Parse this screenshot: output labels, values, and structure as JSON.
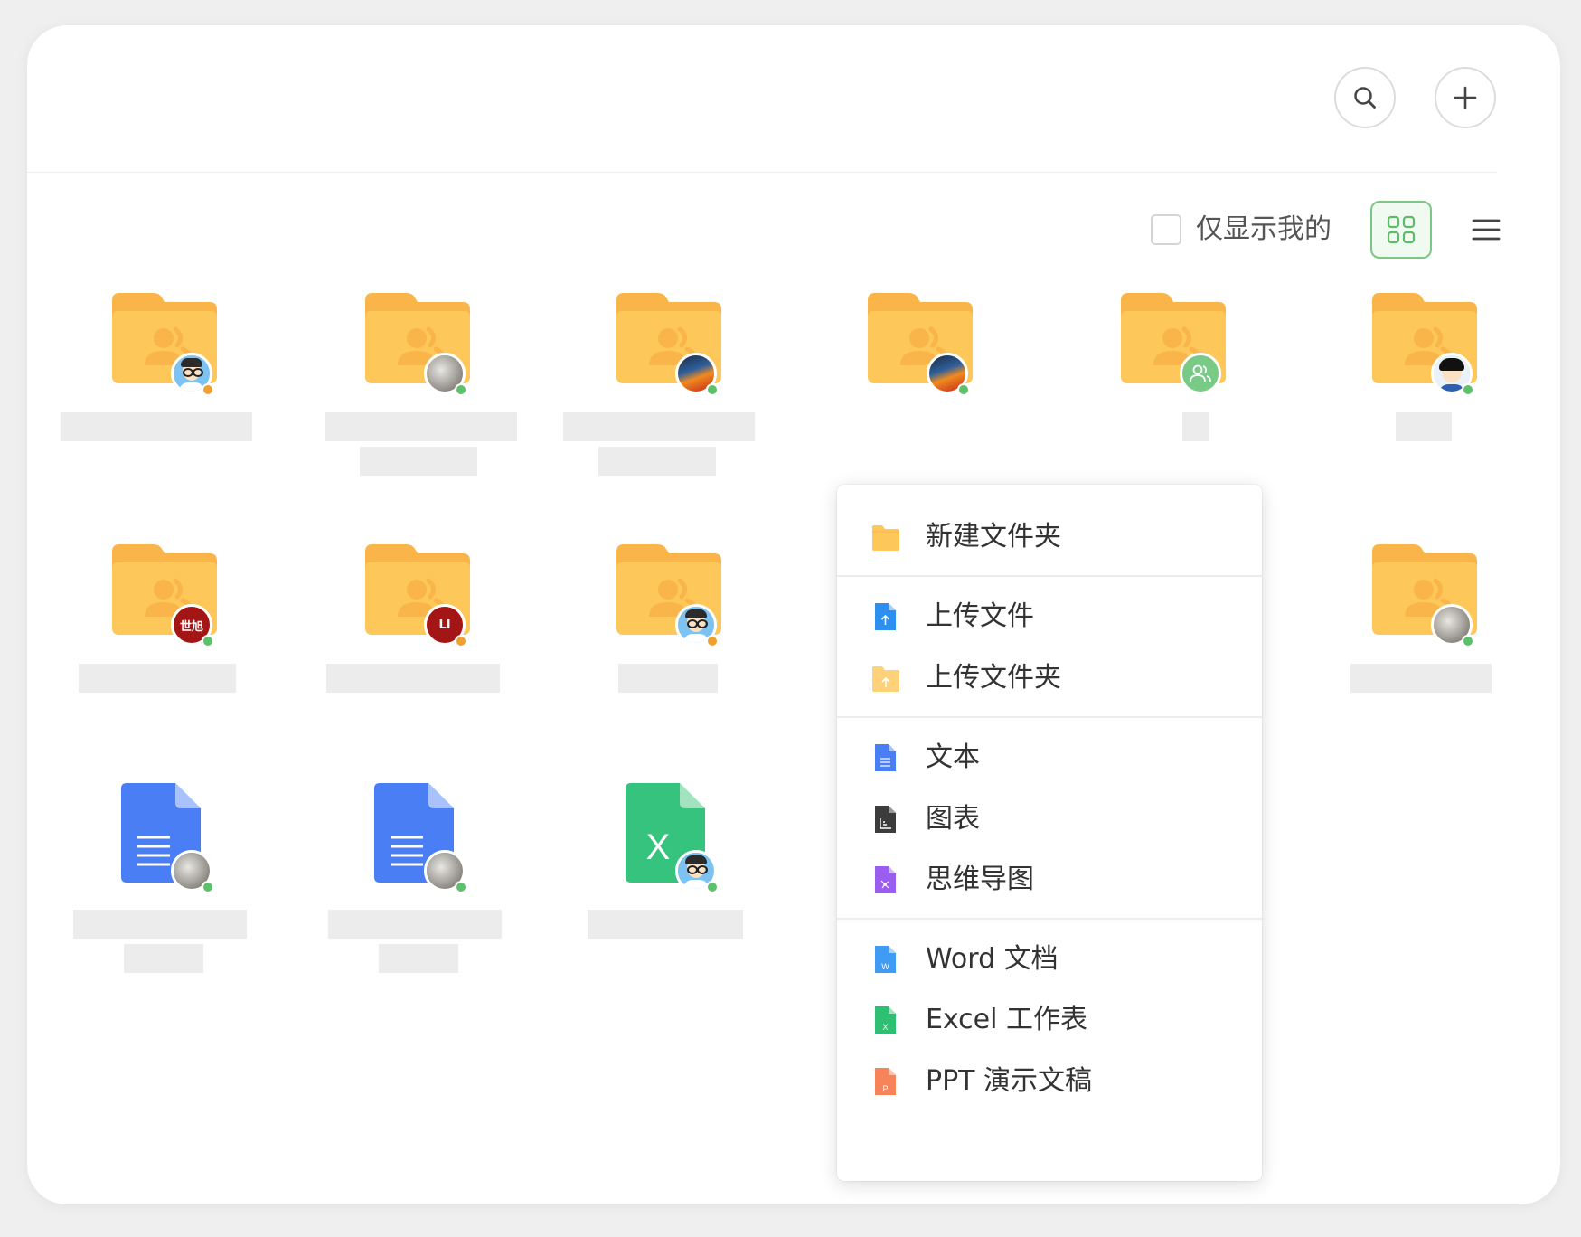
{
  "toolbar": {
    "only_mine_label": "仅显示我的"
  },
  "items": [
    {
      "kind": "folder",
      "avatar": "glasses",
      "dot": "#f0a030"
    },
    {
      "kind": "folder",
      "avatar": "rock",
      "dot": "#5dc06a"
    },
    {
      "kind": "folder",
      "avatar": "bird",
      "dot": "#5dc06a"
    },
    {
      "kind": "folder",
      "avatar": "bird",
      "dot": "#5dc06a"
    },
    {
      "kind": "folder",
      "avatar": "group",
      "dot": ""
    },
    {
      "kind": "folder",
      "avatar": "dark",
      "dot": "#5dc06a"
    },
    {
      "kind": "folder",
      "avatar": "text",
      "avatar_text": "世旭",
      "dot": "#5dc06a"
    },
    {
      "kind": "folder",
      "avatar": "text",
      "avatar_text": "LI",
      "dot": "#f0a030"
    },
    {
      "kind": "folder",
      "avatar": "glasses",
      "dot": "#f0a030"
    },
    {
      "kind": "folder",
      "avatar": "rock",
      "dot": "#5dc06a"
    },
    {
      "kind": "doc",
      "avatar": "rock",
      "dot": "#5dc06a"
    },
    {
      "kind": "doc",
      "avatar": "rock",
      "dot": "#5dc06a"
    },
    {
      "kind": "excel",
      "avatar": "glasses",
      "dot": "#5dc06a",
      "letter": "X"
    }
  ],
  "context_menu": {
    "new_folder": "新建文件夹",
    "upload_file": "上传文件",
    "upload_folder": "上传文件夹",
    "text": "文本",
    "chart": "图表",
    "mind_map": "思维导图",
    "word": "Word 文档",
    "excel": "Excel 工作表",
    "ppt": "PPT 演示文稿"
  },
  "colors": {
    "folder": "#fdc75a",
    "folder_tab": "#f9b54a",
    "doc_blue": "#4a7ef5",
    "excel_green": "#35c37d",
    "accent_green": "#7cc785",
    "avatar_red": "#a41616"
  }
}
